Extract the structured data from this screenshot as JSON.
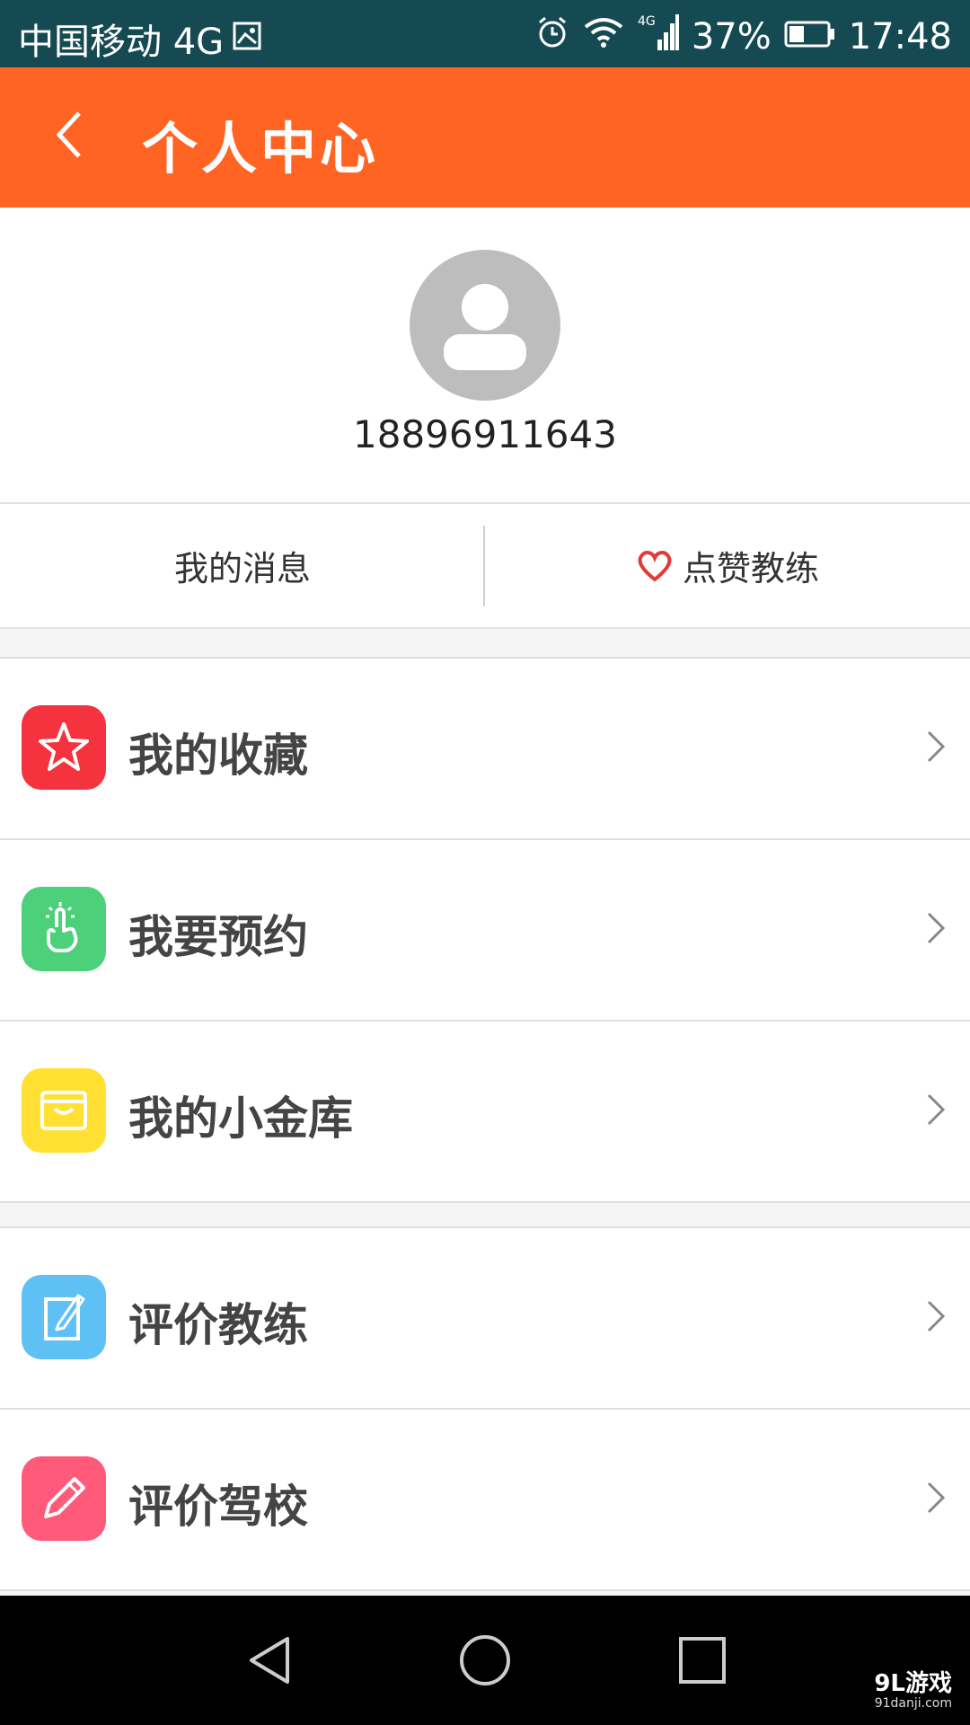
{
  "status_bar": {
    "carrier": "中国移动 4G",
    "battery": "37%",
    "time": "17:48",
    "icons": [
      "image-icon",
      "alarm-icon",
      "wifi-icon",
      "signal-icon",
      "battery-icon"
    ]
  },
  "header": {
    "title": "个人中心",
    "back_icon": "chevron-left-icon",
    "background": "#ff6422"
  },
  "profile": {
    "avatar_icon": "user-avatar-icon",
    "phone": "18896911643"
  },
  "tabs": {
    "messages": "我的消息",
    "likes": "点赞教练",
    "likes_icon": "heart-icon"
  },
  "menu": {
    "group1": [
      {
        "label": "我的收藏",
        "icon": "star-icon",
        "color": "#f5333f"
      },
      {
        "label": "我要预约",
        "icon": "tap-hand-icon",
        "color": "#4cd07a"
      },
      {
        "label": "我的小金库",
        "icon": "wallet-box-icon",
        "color": "#ffe033"
      }
    ],
    "group2": [
      {
        "label": "评价教练",
        "icon": "edit-note-icon",
        "color": "#5ec0f5"
      },
      {
        "label": "评价驾校",
        "icon": "pencil-icon",
        "color": "#ff5a7a"
      }
    ]
  },
  "navbar": {
    "icons": [
      "back-triangle-icon",
      "home-circle-icon",
      "recents-square-icon"
    ]
  },
  "watermark": {
    "brand": "9L游戏",
    "url": "91danji.com"
  }
}
